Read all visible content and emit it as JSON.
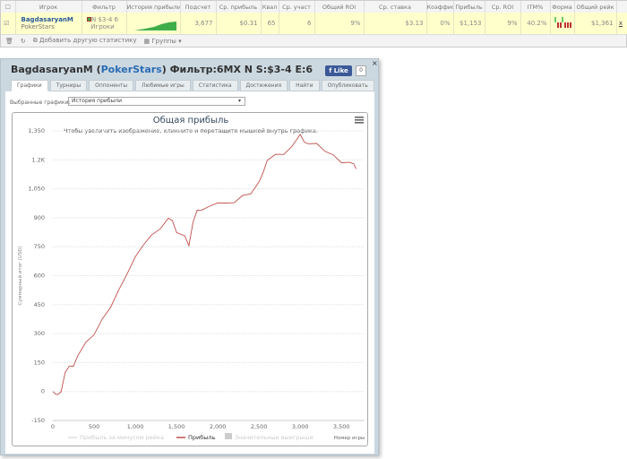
{
  "stats": {
    "headers": [
      "",
      "Игрок",
      "Фильтр",
      "История прибыли",
      "Подсчет",
      "Ср. прибыль",
      "Квал",
      "Ср. участ",
      "Общий ROI",
      "Ср. ставка",
      "Коэффис",
      "Прибыль",
      "Ср. ROI",
      "ITM%",
      "Форма",
      "Общий рейк",
      ""
    ],
    "row": {
      "player": "BagdasaryanM",
      "site": "PokerStars",
      "filter1": "N $3-4 6",
      "filter2": "Игроки",
      "count": "3,677",
      "avg_profit": "$0.31",
      "qual": "65",
      "avg_part": "6",
      "total_roi": "9%",
      "avg_stake": "$3.13",
      "coef": "0%",
      "profit": "$1,153",
      "avg_roi": "9%",
      "itm": "40.2%",
      "rake": "$1,361",
      "remove": "x"
    },
    "footer": {
      "add": "Добавить другую статистику",
      "groups": "Группы"
    }
  },
  "window": {
    "title_player": "BagdasaryanM (",
    "title_site": "PokerStars",
    "title_rest": ") Фильтр:6MX N S:$3-4 E:6",
    "like": "Like",
    "like_count": "0",
    "close": "×",
    "tabs": [
      "Графики",
      "Турниры",
      "Оппоненты",
      "Любимые игры",
      "Статистика",
      "Достижения",
      "Найти",
      "Опубликовать"
    ],
    "selected_label": "Выбранные графики:",
    "selected_value": "История прибыли"
  },
  "chart_data": {
    "type": "line",
    "title": "Общая прибыль",
    "subtitle": "Чтобы увеличить изображение, кликните и перетащите мышкой внутрь графика.",
    "xlabel": "Номер игры",
    "ylabel": "Суммарный итог (USD)",
    "xlim": [
      0,
      3700
    ],
    "ylim": [
      -150,
      1350
    ],
    "xticks": [
      0,
      500,
      1000,
      1500,
      2000,
      2500,
      3000,
      3500
    ],
    "xtick_labels": [
      "0",
      "500",
      "1,000",
      "1,500",
      "2,000",
      "2,500",
      "3,000",
      "3,500"
    ],
    "yticks": [
      -150,
      0,
      150,
      300,
      450,
      600,
      750,
      900,
      1050,
      1200,
      1350
    ],
    "ytick_labels": [
      "-150",
      "0",
      "150",
      "300",
      "450",
      "600",
      "750",
      "900",
      "1,050",
      "1.2K",
      "1,350"
    ],
    "legend": [
      "Прибыль за минусом рейка",
      "Прибыль",
      "Значительные выигрыши"
    ],
    "series": [
      {
        "name": "Прибыль",
        "color": "#c0504d",
        "points": [
          [
            0,
            0
          ],
          [
            30,
            -10
          ],
          [
            60,
            -25
          ],
          [
            100,
            10
          ],
          [
            150,
            100
          ],
          [
            200,
            120
          ],
          [
            250,
            140
          ],
          [
            300,
            180
          ],
          [
            400,
            240
          ],
          [
            500,
            300
          ],
          [
            600,
            370
          ],
          [
            700,
            450
          ],
          [
            800,
            530
          ],
          [
            900,
            600
          ],
          [
            1000,
            710
          ],
          [
            1100,
            760
          ],
          [
            1200,
            800
          ],
          [
            1300,
            850
          ],
          [
            1400,
            895
          ],
          [
            1450,
            870
          ],
          [
            1500,
            830
          ],
          [
            1600,
            800
          ],
          [
            1650,
            770
          ],
          [
            1700,
            880
          ],
          [
            1750,
            930
          ],
          [
            1800,
            950
          ],
          [
            1900,
            960
          ],
          [
            2000,
            965
          ],
          [
            2100,
            985
          ],
          [
            2200,
            975
          ],
          [
            2300,
            1000
          ],
          [
            2400,
            1030
          ],
          [
            2500,
            1080
          ],
          [
            2550,
            1150
          ],
          [
            2600,
            1200
          ],
          [
            2700,
            1220
          ],
          [
            2800,
            1240
          ],
          [
            2900,
            1270
          ],
          [
            3000,
            1320
          ],
          [
            3050,
            1300
          ],
          [
            3100,
            1280
          ],
          [
            3200,
            1270
          ],
          [
            3300,
            1250
          ],
          [
            3400,
            1220
          ],
          [
            3500,
            1200
          ],
          [
            3600,
            1190
          ],
          [
            3650,
            1170
          ],
          [
            3677,
            1153
          ]
        ]
      }
    ]
  }
}
